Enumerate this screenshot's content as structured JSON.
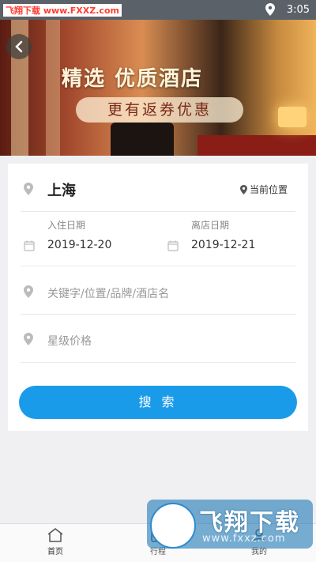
{
  "status_bar": {
    "watermark_text": "飞翔下载 www.FXXZ.com",
    "time": "3:05"
  },
  "banner": {
    "title": "精选 优质酒店",
    "subtitle": "更有返券优惠"
  },
  "search_form": {
    "city": "上海",
    "current_location_label": "当前位置",
    "checkin_label": "入住日期",
    "checkin_value": "2019-12-20",
    "checkout_label": "离店日期",
    "checkout_value": "2019-12-21",
    "keyword_placeholder": "关键字/位置/品牌/酒店名",
    "star_price_placeholder": "星级价格",
    "search_button_label": "搜 索"
  },
  "bottom_nav": {
    "items": [
      {
        "label": "首页",
        "icon": "home-icon"
      },
      {
        "label": "行程",
        "icon": "itinerary-icon"
      },
      {
        "label": "我的",
        "icon": "profile-icon"
      }
    ]
  },
  "watermark": {
    "brand": "飞翔下载",
    "url": "www.fxxz.com"
  },
  "colors": {
    "accent": "#1a9bea",
    "status_bar": "#5a6168"
  }
}
